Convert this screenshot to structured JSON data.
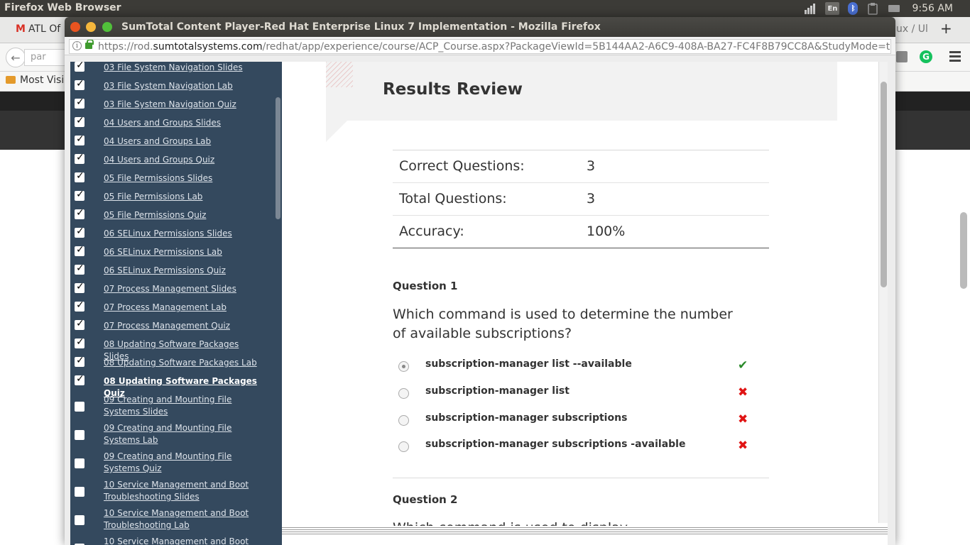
{
  "system": {
    "app_title": "Firefox Web Browser",
    "keyboard_layout": "En",
    "clock": "9:56 AM",
    "icons": [
      "signal-icon",
      "bluetooth-icon",
      "clipboard-icon",
      "battery-icon"
    ]
  },
  "background_window": {
    "tab_label": "ATL Of",
    "tab_right_label": "ux / Ul",
    "url_fragment": "par",
    "bookmark_label": "Most Visi",
    "grammarly_letter": "G"
  },
  "popup": {
    "title": "SumTotal Content Player-Red Hat Enterprise Linux 7 Implementation - Mozilla Firefox",
    "url_prefix": "https://rod.",
    "url_domain": "sumtotalsystems.com",
    "url_path": "/redhat/app/experience/course/ACP_Course.aspx?PackageViewId=5B144AA2-A6C9-408A-BA27-FC4F8B79CC8A&StudyMode=true"
  },
  "sidebar": {
    "items": [
      {
        "label": "03 File System Navigation Slides",
        "checked": true
      },
      {
        "label": "03 File System Navigation Lab",
        "checked": true
      },
      {
        "label": "03 File System Navigation Quiz",
        "checked": true
      },
      {
        "label": "04 Users and Groups Slides",
        "checked": true
      },
      {
        "label": "04 Users and Groups Lab",
        "checked": true
      },
      {
        "label": "04 Users and Groups Quiz",
        "checked": true
      },
      {
        "label": "05 File Permissions Slides",
        "checked": true
      },
      {
        "label": "05 File Permissions Lab",
        "checked": true
      },
      {
        "label": "05 File Permissions Quiz",
        "checked": true
      },
      {
        "label": "06 SELinux Permissions Slides",
        "checked": true
      },
      {
        "label": "06 SELinux Permissions Lab",
        "checked": true
      },
      {
        "label": "06 SELinux Permissions Quiz",
        "checked": true
      },
      {
        "label": "07 Process Management Slides",
        "checked": true
      },
      {
        "label": "07 Process Management Lab",
        "checked": true
      },
      {
        "label": "07 Process Management Quiz",
        "checked": true
      },
      {
        "label": "08 Updating Software Packages Slides",
        "checked": true
      },
      {
        "label": "08 Updating Software Packages Lab",
        "checked": true
      },
      {
        "label": "08 Updating Software Packages Quiz",
        "checked": true,
        "current": true
      },
      {
        "label": "09 Creating and Mounting File Systems Slides",
        "checked": false
      },
      {
        "label": "09 Creating and Mounting File Systems Lab",
        "checked": false
      },
      {
        "label": "09 Creating and Mounting File Systems Quiz",
        "checked": false
      },
      {
        "label": "10 Service Management and Boot Troubleshooting Slides",
        "checked": false
      },
      {
        "label": "10 Service Management and Boot Troubleshooting Lab",
        "checked": false
      },
      {
        "label": "10 Service Management and Boot",
        "checked": false
      }
    ]
  },
  "results": {
    "title": "Results Review",
    "stats": [
      {
        "label": "Correct Questions:",
        "value": "3"
      },
      {
        "label": "Total Questions:",
        "value": "3"
      },
      {
        "label": "Accuracy:",
        "value": "100%"
      }
    ],
    "question1": {
      "heading": "Question 1",
      "text": "Which command is used to determine the number of available subscriptions?",
      "options": [
        {
          "text": "subscription-manager list --available",
          "selected": true,
          "correct": true
        },
        {
          "text": "subscription-manager list",
          "selected": false,
          "correct": false
        },
        {
          "text": "subscription-manager subscriptions",
          "selected": false,
          "correct": false
        },
        {
          "text": "subscription-manager subscriptions -available",
          "selected": false,
          "correct": false
        }
      ]
    },
    "question2": {
      "heading": "Question 2",
      "text_partial": "Which command is used to display"
    }
  },
  "colors": {
    "sidebar_bg": "#34495e",
    "correct": "#2a8a2a",
    "incorrect": "#e01414"
  }
}
